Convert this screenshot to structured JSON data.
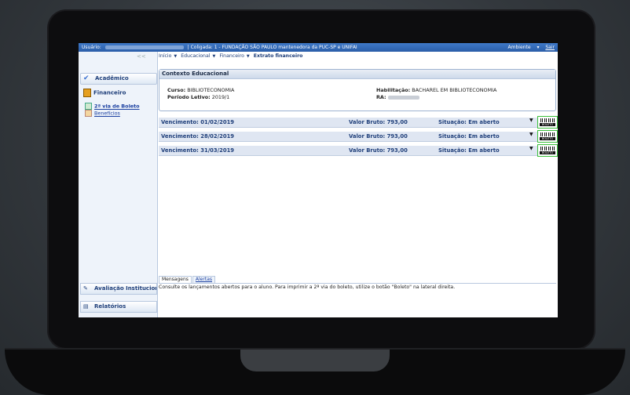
{
  "topbar": {
    "user_label": "Usuário:",
    "coligada": "| Coligada: 1 - FUNDAÇÃO SÃO PAULO mantenedora da PUC-SP e UNIFAI",
    "ambiente": "Ambiente",
    "sair": "Sair"
  },
  "sidebar": {
    "collapse": "<<",
    "academico": "Acadêmico",
    "financeiro": "Financeiro",
    "items": [
      {
        "label": "2ª via de Boleto"
      },
      {
        "label": "Benefícios"
      }
    ],
    "avaliacao": "Avaliação Institucional",
    "relatorios": "Relatórios"
  },
  "breadcrumb": {
    "inicio": "Início",
    "educacional": "Educacional",
    "financeiro": "Financeiro",
    "current": "Extrato financeiro"
  },
  "context": {
    "title": "Contexto Educacional",
    "curso_label": "Curso:",
    "curso_value": "BIBLIOTECONOMIA",
    "periodo_label": "Período Letivo:",
    "periodo_value": "2019/1",
    "habilitacao_label": "Habilitação:",
    "habilitacao_value": "BACHAREL EM BIBLIOTECONOMIA",
    "ra_label": "RA:"
  },
  "payments": [
    {
      "vencimento": "Vencimento: 01/02/2019",
      "valor": "Valor Bruto: 793,00",
      "situacao": "Situação: Em aberto"
    },
    {
      "vencimento": "Vencimento: 28/02/2019",
      "valor": "Valor Bruto: 793,00",
      "situacao": "Situação: Em aberto"
    },
    {
      "vencimento": "Vencimento: 31/03/2019",
      "valor": "Valor Bruto: 793,00",
      "situacao": "Situação: Em aberto"
    }
  ],
  "boleto_label": "BOLETO",
  "messages": {
    "tab_mensagens": "Mensagens",
    "tab_alertas": "Alertas",
    "text": "Consulte os lançamentos abertos para o aluno. Para imprimir a 2ª via do boleto, utilize o botão \"Boleto\" na lateral direita."
  }
}
